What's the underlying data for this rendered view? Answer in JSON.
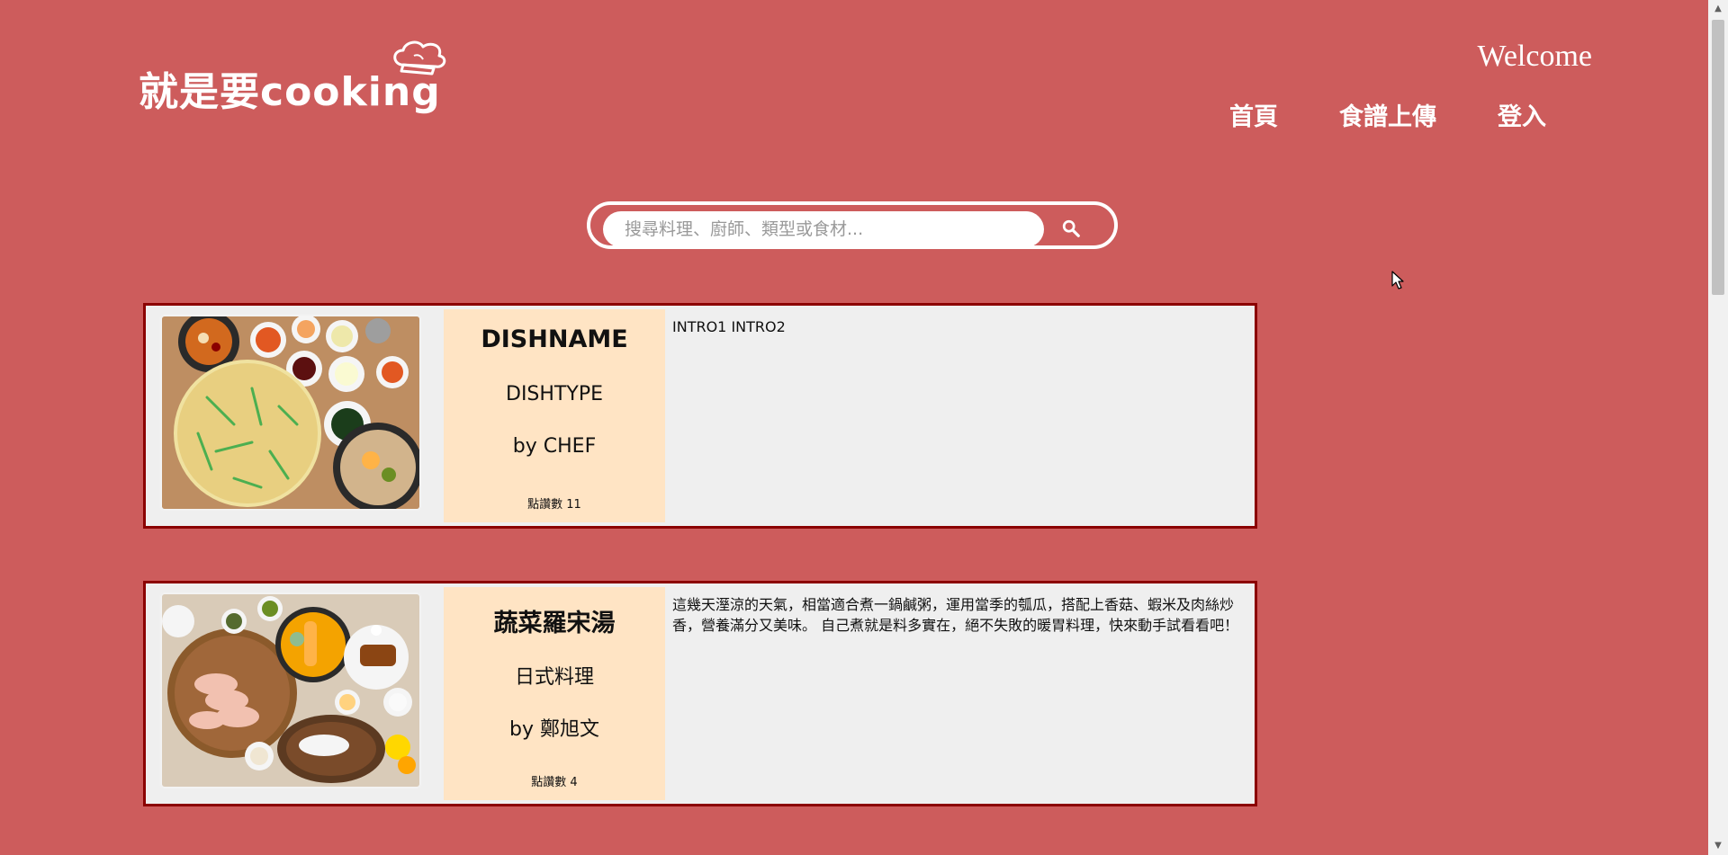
{
  "header": {
    "logo_text": "就是要cooking",
    "welcome": "Welcome",
    "nav": [
      {
        "label": "首頁"
      },
      {
        "label": "食譜上傳"
      },
      {
        "label": "登入"
      }
    ]
  },
  "search": {
    "placeholder": "搜尋料理、廚師、類型或食材..."
  },
  "recipes": [
    {
      "name": "DISHNAME",
      "type": "DISHTYPE",
      "chef": "by CHEF",
      "likes": "點讚數 11",
      "intro": "INTRO1 INTRO2",
      "photo": "korean-food-spread-photo"
    },
    {
      "name": "蔬菜羅宋湯",
      "type": "日式料理",
      "chef": "by 鄭旭文",
      "likes": "點讚數 4",
      "intro": "這幾天溼涼的天氣，相當適合煮一鍋鹹粥，運用當季的瓠瓜，搭配上香菇、蝦米及肉絲炒香，營養滿分又美味。 自己煮就是料多實在，絕不失敗的暖胃料理，快來動手試看看吧！",
      "photo": "japanese-food-spread-photo"
    }
  ],
  "colors": {
    "background": "#cd5c5c",
    "card_border": "#8b0000",
    "info_panel": "#ffe4c4",
    "card_bg": "#efefef"
  }
}
